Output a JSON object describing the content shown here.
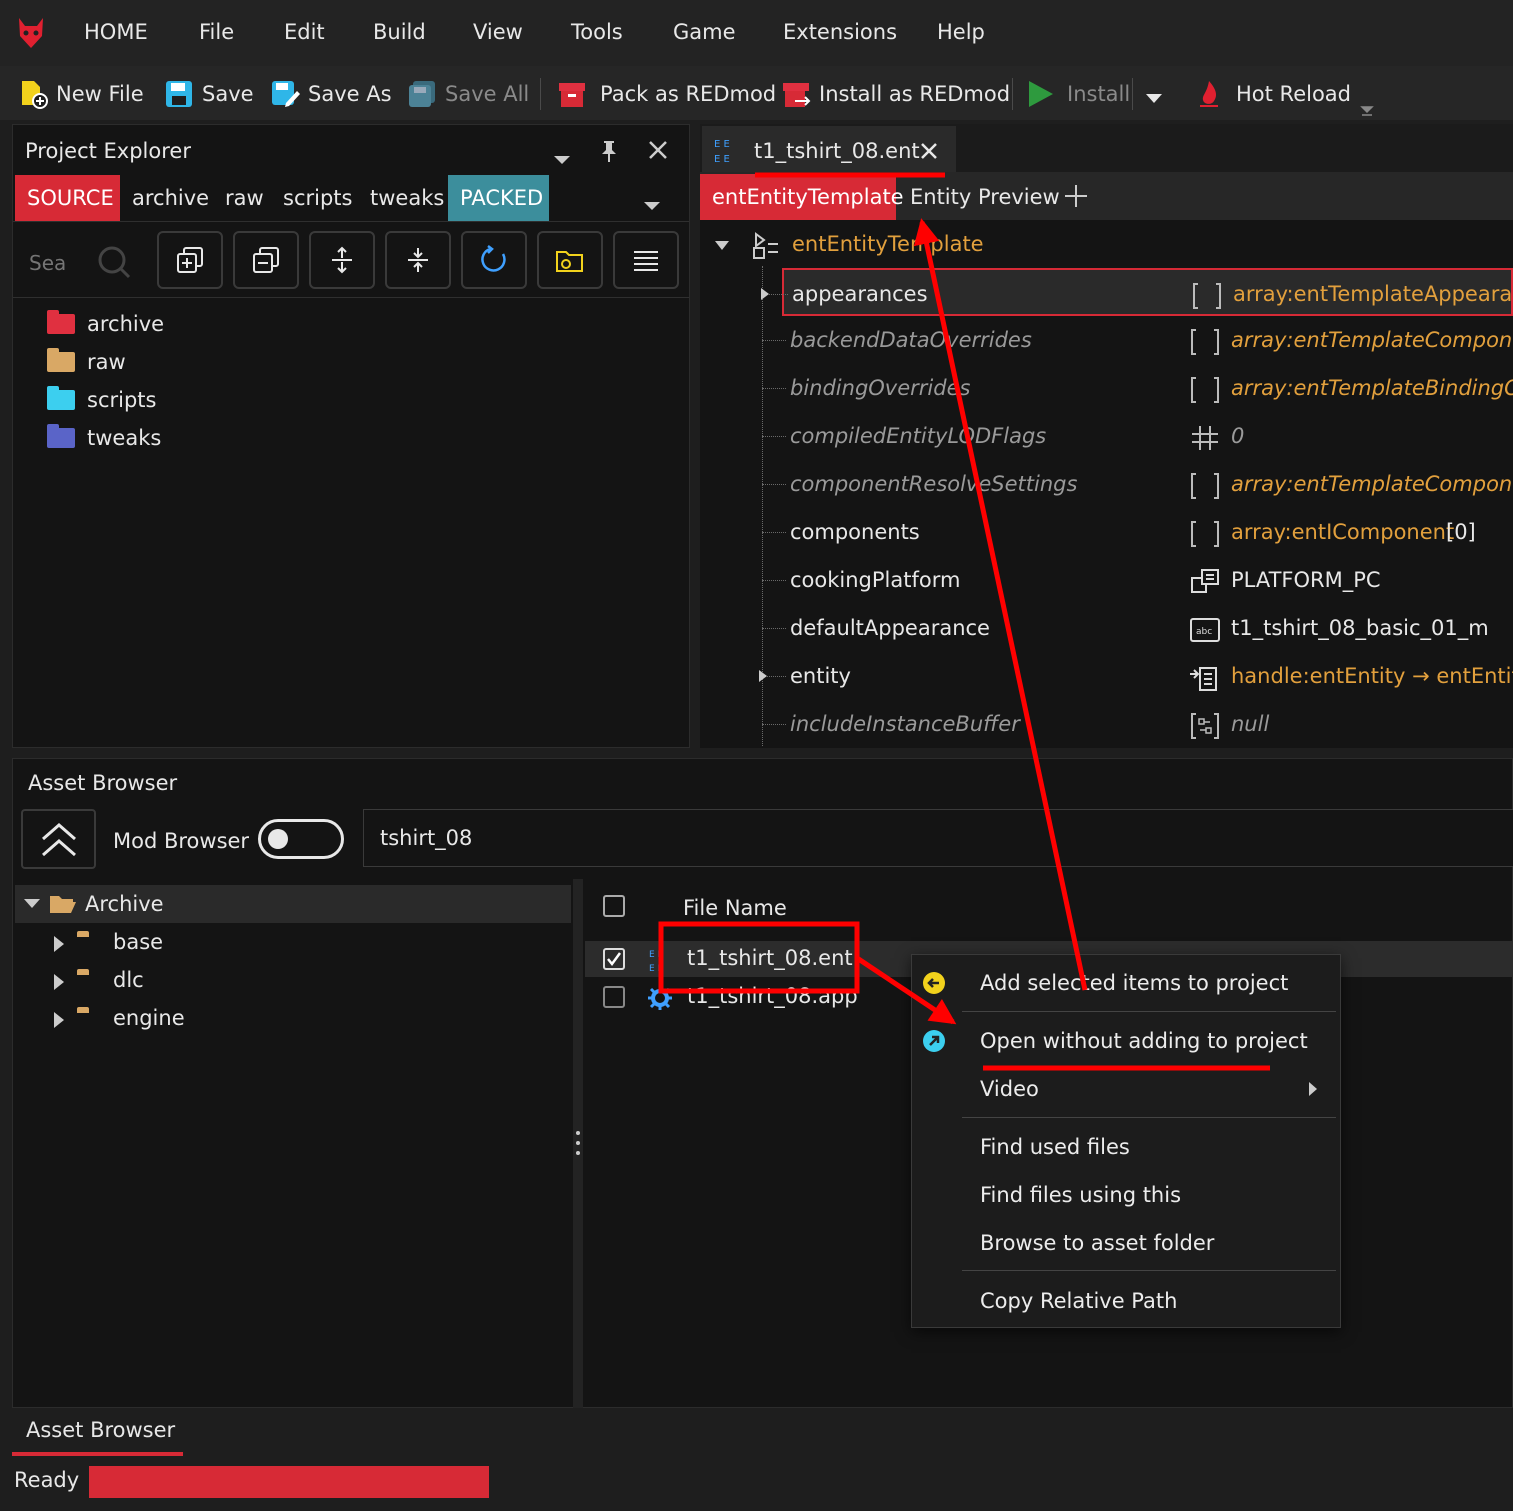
{
  "menu": {
    "items": [
      "HOME",
      "File",
      "Edit",
      "Build",
      "View",
      "Tools",
      "Game",
      "Extensions",
      "Help"
    ]
  },
  "toolbar": {
    "new_file": "New File",
    "save": "Save",
    "save_as": "Save As",
    "save_all": "Save All",
    "pack": "Pack as REDmod",
    "install_redmod": "Install as REDmod",
    "install": "Install",
    "hot_reload": "Hot Reload"
  },
  "project_explorer": {
    "title": "Project Explorer",
    "tabs": [
      "SOURCE",
      "archive",
      "raw",
      "scripts",
      "tweaks",
      "PACKED"
    ],
    "search_placeholder": "Sea",
    "folders": [
      {
        "name": "archive",
        "color": "#e03040"
      },
      {
        "name": "raw",
        "color": "#d9a865"
      },
      {
        "name": "scripts",
        "color": "#3ccfef"
      },
      {
        "name": "tweaks",
        "color": "#5a64c8"
      }
    ]
  },
  "editor": {
    "file_tab": "t1_tshirt_08.ent",
    "subtabs": [
      "entEntityTemplate",
      "Entity Preview"
    ],
    "root": "entEntityTemplate",
    "properties": [
      {
        "name": "appearances",
        "value": "array:entTemplateAppearance",
        "italic": false,
        "orange": true,
        "icon": "[ ]"
      },
      {
        "name": "backendDataOverrides",
        "value": "array:entTemplateComponent",
        "italic": true,
        "orange": true,
        "icon": "[ ]"
      },
      {
        "name": "bindingOverrides",
        "value": "array:entTemplateBindingOve",
        "italic": true,
        "orange": true,
        "icon": "[ ]"
      },
      {
        "name": "compiledEntityLODFlags",
        "value": "0",
        "italic": true,
        "orange": false,
        "icon": "#"
      },
      {
        "name": "componentResolveSettings",
        "value": "array:entTemplateComponent",
        "italic": true,
        "orange": true,
        "icon": "[ ]"
      },
      {
        "name": "components",
        "value": "array:entIComponent",
        "value2": "[0]",
        "italic": false,
        "orange": true,
        "icon": "[ ]"
      },
      {
        "name": "cookingPlatform",
        "value": "PLATFORM_PC",
        "italic": false,
        "orange": false,
        "icon": "enum"
      },
      {
        "name": "defaultAppearance",
        "value": "t1_tshirt_08_basic_01_m",
        "italic": false,
        "orange": false,
        "icon": "abc"
      },
      {
        "name": "entity",
        "value": "handle:entEntity → entEntity",
        "italic": false,
        "orange": true,
        "icon": "handle"
      },
      {
        "name": "includeInstanceBuffer",
        "value": "null",
        "italic": true,
        "orange": false,
        "icon": "buf"
      }
    ]
  },
  "asset_browser": {
    "title": "Asset Browser",
    "mod_browser": "Mod Browser",
    "search_value": "tshirt_08",
    "tree_root": "Archive",
    "tree_children": [
      "base",
      "dlc",
      "engine"
    ],
    "column_file_name": "File Name",
    "files": [
      {
        "name": "t1_tshirt_08.ent",
        "checked": true
      },
      {
        "name": "t1_tshirt_08.app",
        "checked": false
      }
    ]
  },
  "context_menu": {
    "items": [
      "Add selected items to project",
      "Open without adding to project",
      "Video",
      "Find used files",
      "Find files using this",
      "Browse to asset folder",
      "Copy Relative Path"
    ]
  },
  "bottom_tab": "Asset Browser",
  "status": "Ready",
  "colors": {
    "accent_red": "#d72a36",
    "teal": "#3c8e9c",
    "orange_value": "#e2a03d",
    "annotation_red": "#ff0000"
  }
}
